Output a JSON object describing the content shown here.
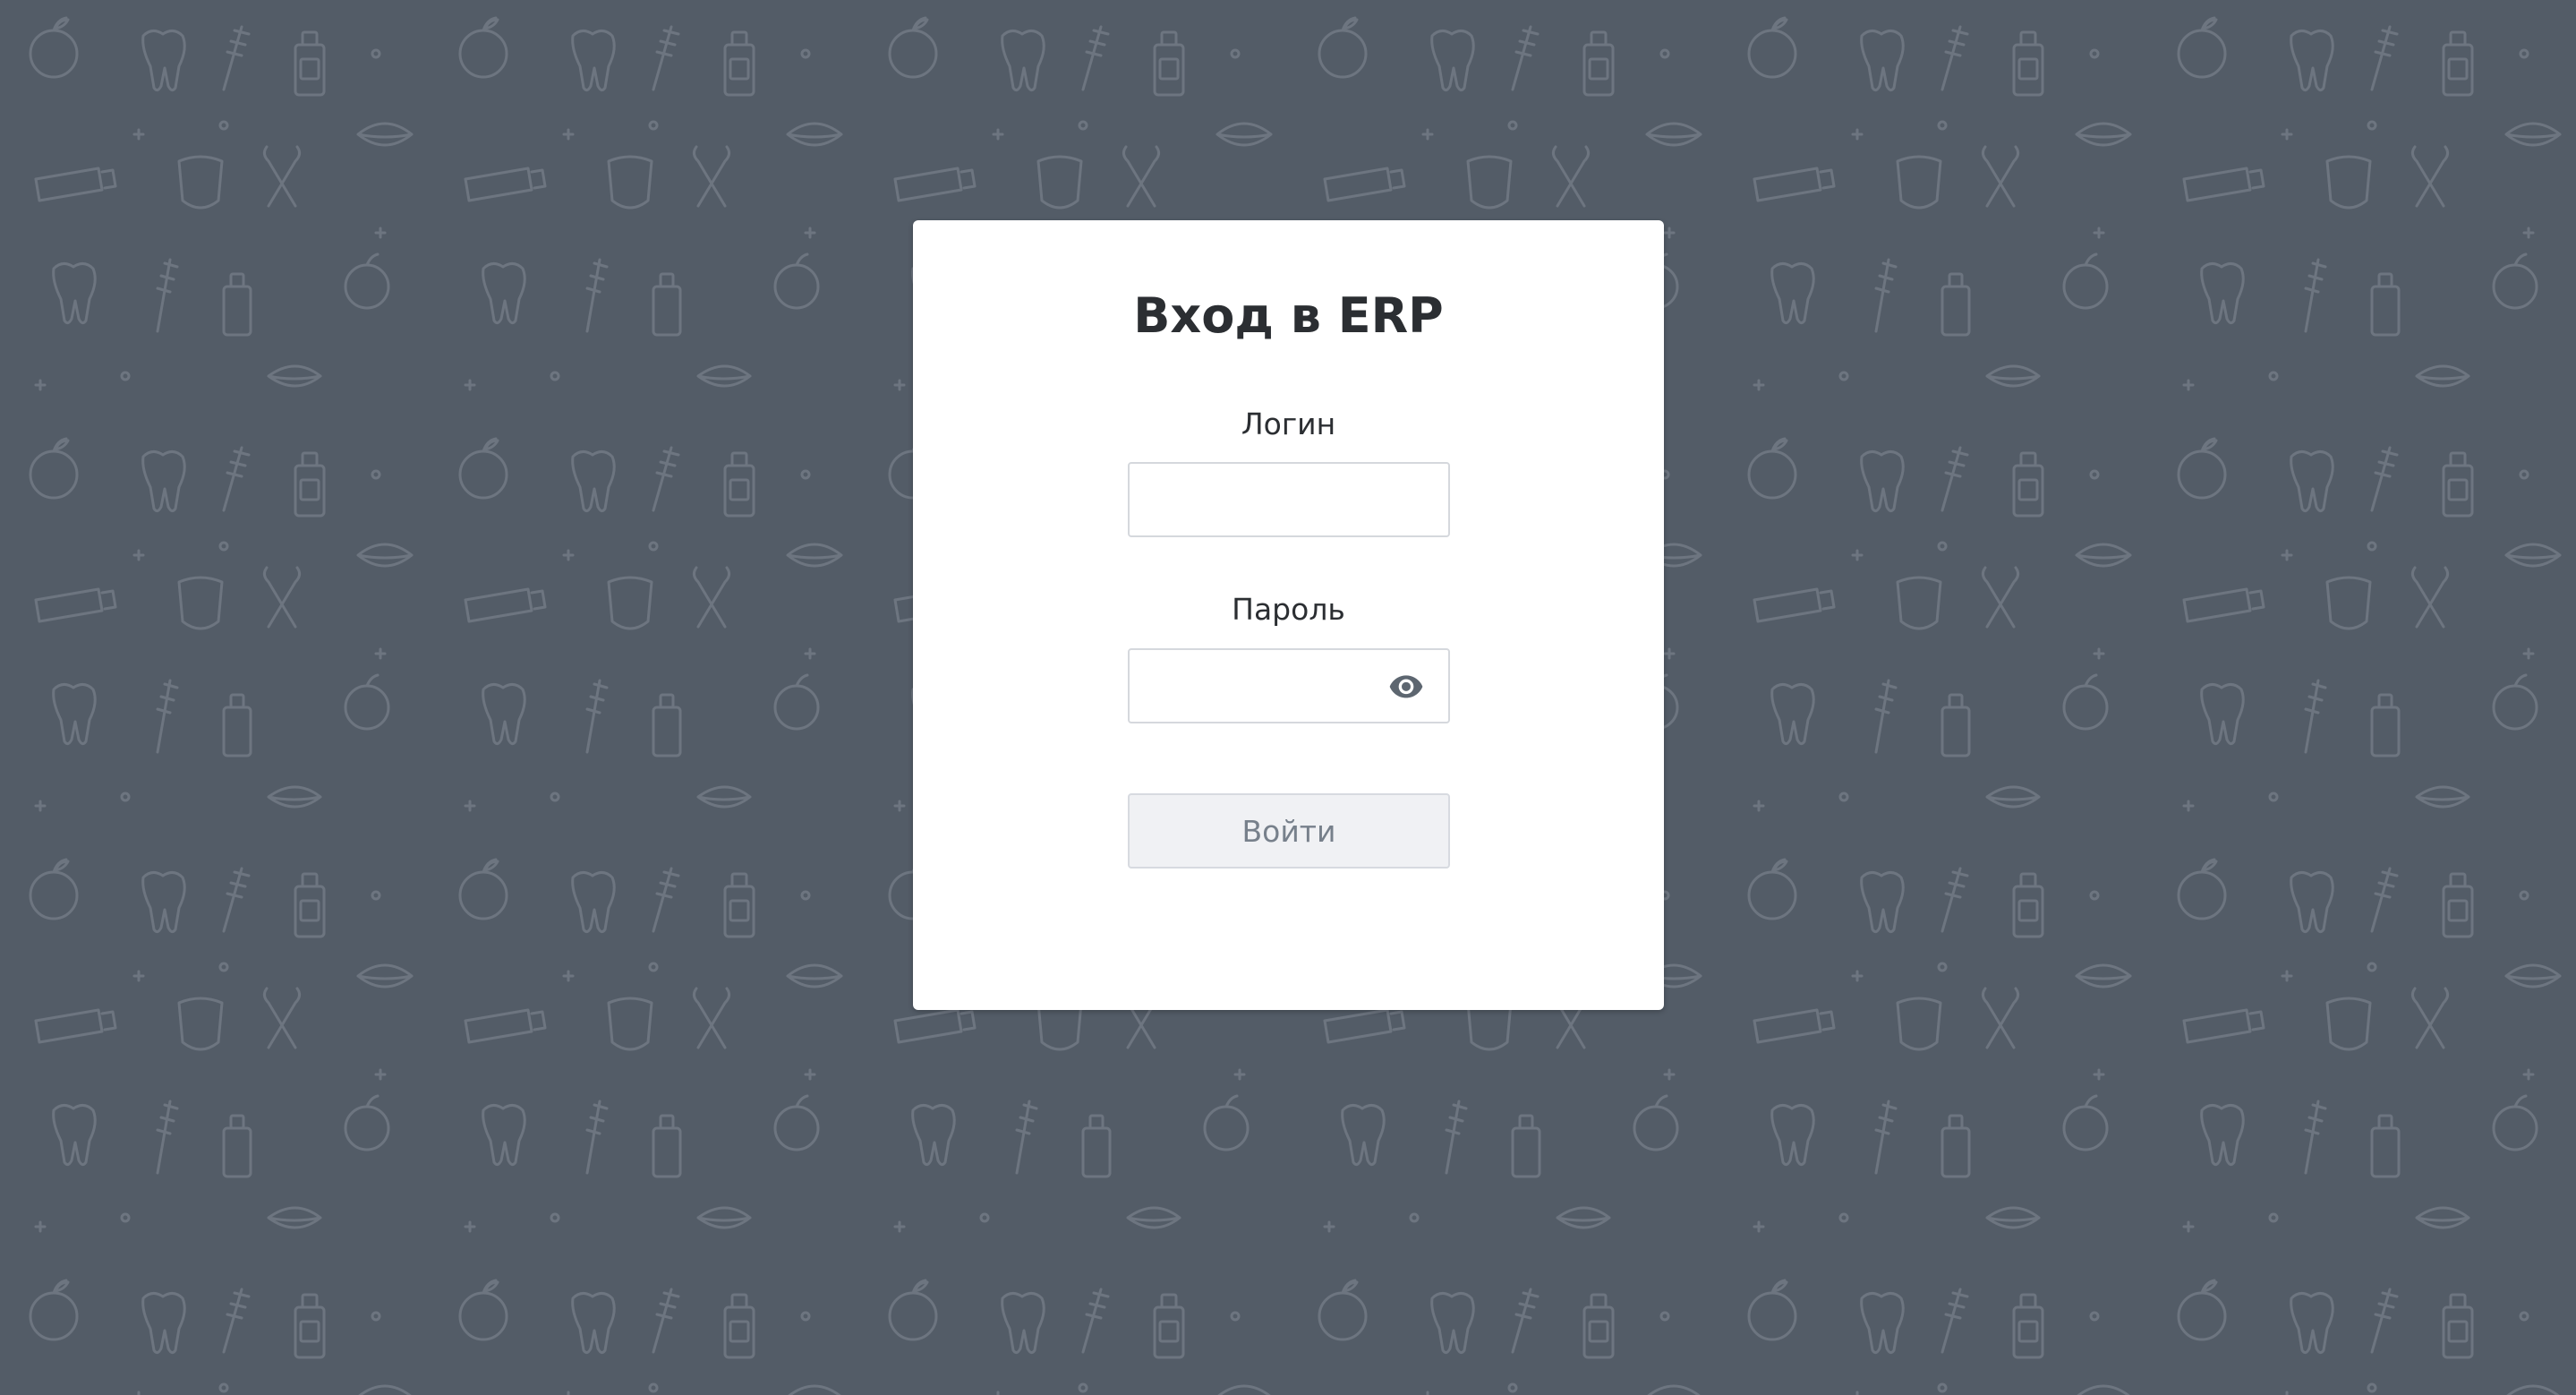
{
  "login_form": {
    "title": "Вход в ERP",
    "login_label": "Логин",
    "login_value": "",
    "password_label": "Пароль",
    "password_value": "",
    "password_toggle_icon": "eye-icon",
    "submit_label": "Войти"
  },
  "background": {
    "color": "#535c67",
    "pattern": "dental-doodle-pattern"
  }
}
